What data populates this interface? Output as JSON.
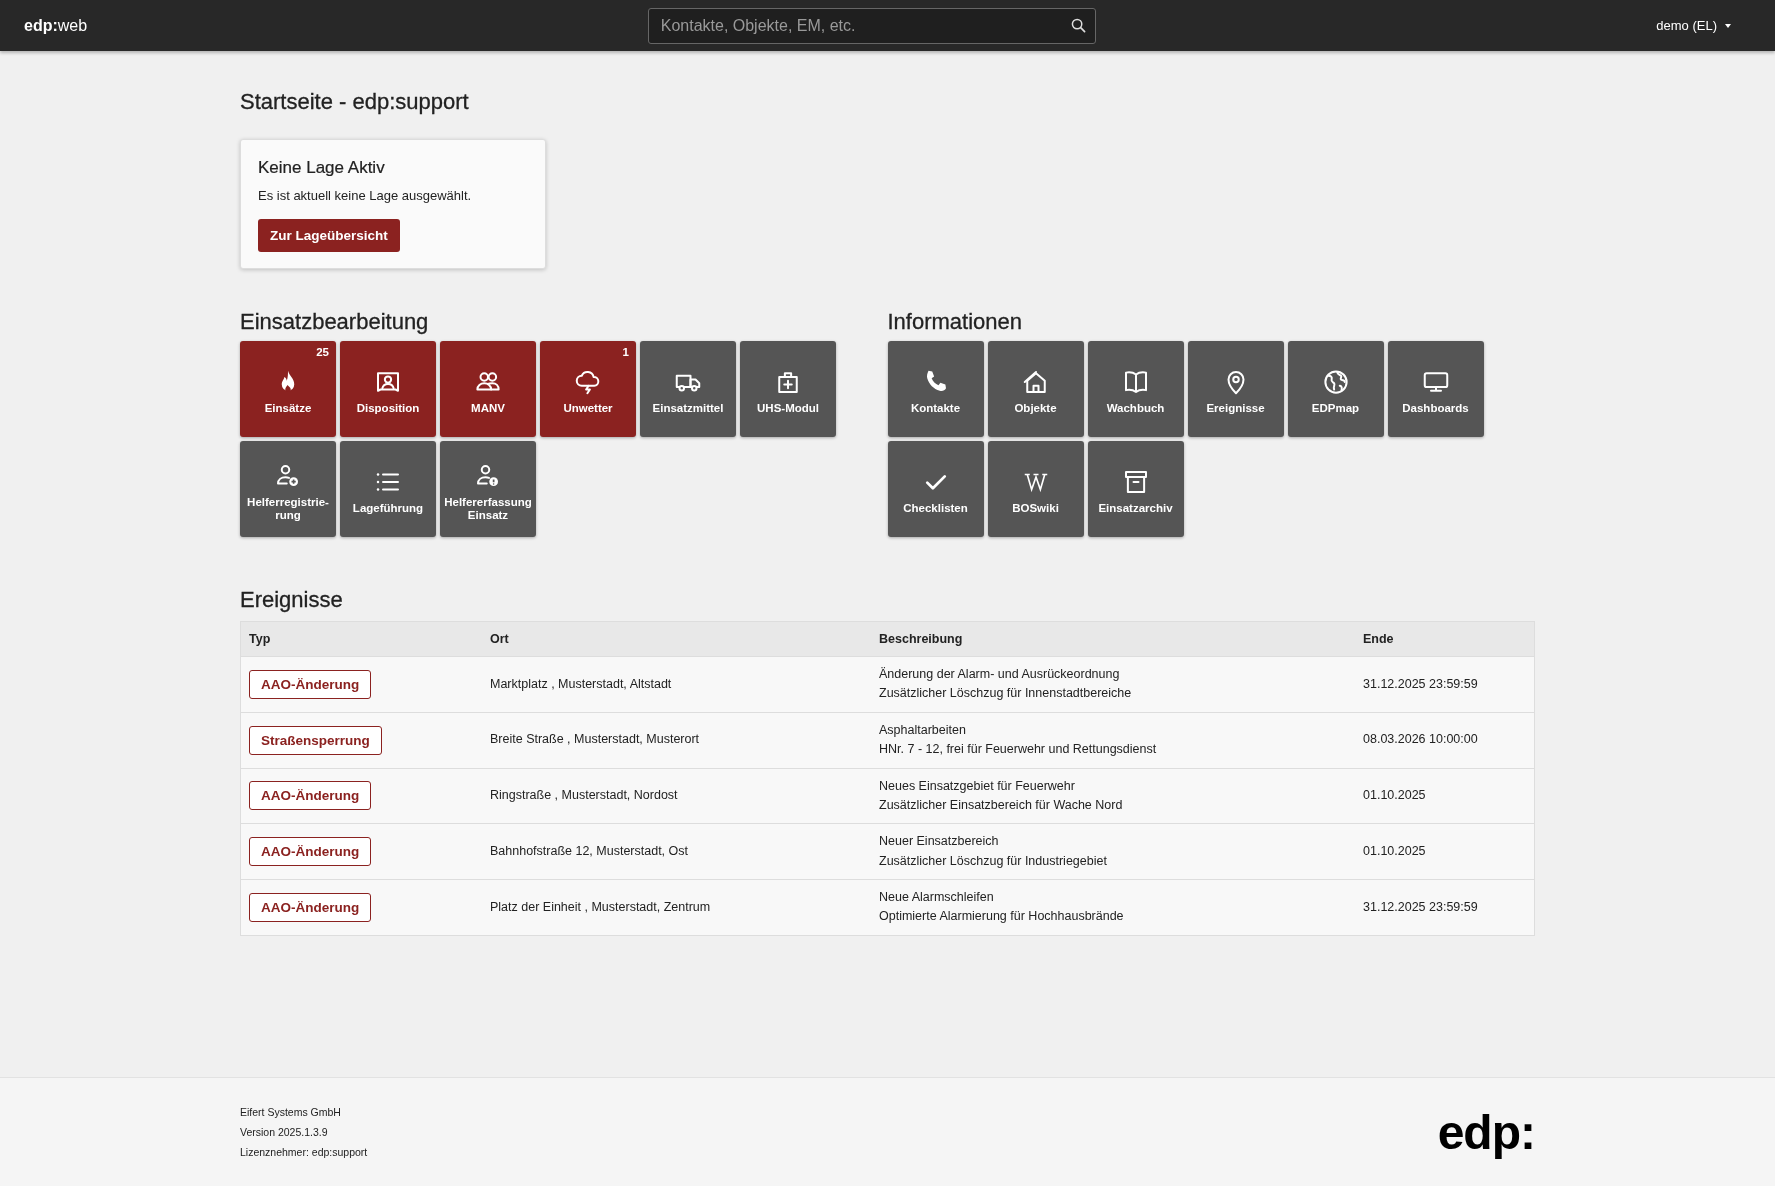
{
  "header": {
    "logo": "**edp:**web",
    "search": {
      "placeholder": "Kontakte, Objekte, EM, etc."
    },
    "user_menu": "demo (EL)"
  },
  "page_title": "Startseite - edp:support",
  "status_card": {
    "title": "Keine Lage Aktiv",
    "text": "Es ist aktuell keine Lage ausgewählt.",
    "button": "Zur Lageübersicht"
  },
  "sections": [
    {
      "title": "Einsatzbearbeitung",
      "tiles": [
        {
          "label": "Einsätze",
          "kind": "highlight",
          "badge": "25"
        },
        {
          "label": "Disposition",
          "kind": "highlight"
        },
        {
          "label": "MANV",
          "kind": "highlight"
        },
        {
          "label": "Unwetter",
          "kind": "highlight",
          "badge": "1"
        },
        {
          "label": "Einsatzmittel",
          "kind": "normal"
        },
        {
          "label": "UHS-Modul",
          "kind": "normal"
        },
        {
          "label": "Helferregistrie-\nrung",
          "kind": "normal"
        },
        {
          "label": "Lageführung",
          "kind": "normal"
        },
        {
          "label": "Helfererfassung\nEinsatz",
          "kind": "normal"
        }
      ]
    },
    {
      "title": "Informationen",
      "tiles": [
        {
          "label": "Kontakte",
          "kind": "normal"
        },
        {
          "label": "Objekte",
          "kind": "normal"
        },
        {
          "label": "Wachbuch",
          "kind": "normal"
        },
        {
          "label": "Ereignisse",
          "kind": "normal"
        },
        {
          "label": "EDPmap",
          "kind": "normal"
        },
        {
          "label": "Dashboards",
          "kind": "normal"
        },
        {
          "label": "Checklisten",
          "kind": "normal"
        },
        {
          "label": "BOSwiki",
          "kind": "normal"
        },
        {
          "label": "Einsatzarchiv",
          "kind": "normal"
        }
      ]
    }
  ],
  "events": {
    "title": "Ereignisse",
    "columns": [
      "Typ",
      "Ort",
      "Beschreibung",
      "Ende"
    ],
    "rows": [
      {
        "type": "AAO-Änderung",
        "location": "Marktplatz , Musterstadt, Altstadt",
        "description": [
          "Änderung der Alarm- und Ausrückeordnung",
          "Zusätzlicher Löschzug für Innenstadtbereiche"
        ],
        "end": "31.12.2025 23:59:59"
      },
      {
        "type": "Straßensperrung",
        "location": "Breite Straße , Musterstadt, Musterort",
        "description": [
          "Asphaltarbeiten",
          "HNr. 7 - 12, frei für Feuerwehr und Rettungsdienst"
        ],
        "end": "08.03.2026 10:00:00"
      },
      {
        "type": "AAO-Änderung",
        "location": "Ringstraße , Musterstadt, Nordost",
        "description": [
          "Neues Einsatzgebiet für Feuerwehr",
          "Zusätzlicher Einsatzbereich für Wache Nord"
        ],
        "end": "01.10.2025"
      },
      {
        "type": "AAO-Änderung",
        "location": "Bahnhofstraße 12, Musterstadt, Ost",
        "description": [
          "Neuer Einsatzbereich",
          "Zusätzlicher Löschzug für Industriegebiet"
        ],
        "end": "01.10.2025"
      },
      {
        "type": "AAO-Änderung",
        "location": "Platz der Einheit , Musterstadt, Zentrum",
        "description": [
          "Neue Alarmschleifen",
          "Optimierte Alarmierung für Hochhausbrände"
        ],
        "end": "31.12.2025 23:59:59"
      }
    ]
  },
  "footer": {
    "lines": [
      "Eifert Systems GmbH",
      "Version 2025.1.3.9",
      "Lizenznehmer: edp:support"
    ],
    "logo": "edp:"
  }
}
